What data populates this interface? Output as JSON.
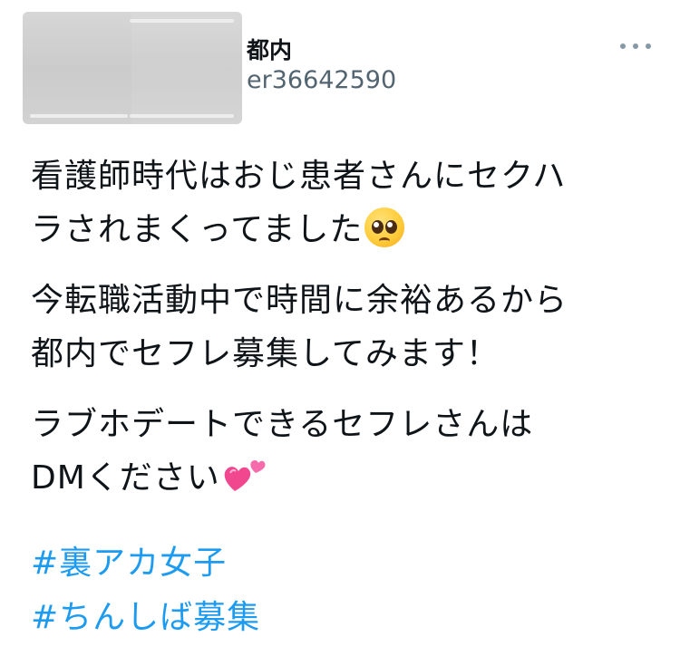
{
  "user": {
    "display_name": "都内",
    "handle": "er36642590"
  },
  "tweet": {
    "paragraphs": [
      "看護師時代はおじ患者さんにセクハ\nラされまくってました",
      "今転職活動中で時間に余裕あるから\n都内でセフレ募集してみます！",
      "ラブホデートできるセフレさんは\nDMください"
    ],
    "emoji_1": "pleading-face",
    "emoji_2": "two-hearts"
  },
  "hashtags": [
    "#裏アカ女子",
    "#ちんしば募集"
  ],
  "colors": {
    "hashtag": "#1d9bf0",
    "handle": "#536471",
    "text": "#0f1419"
  }
}
